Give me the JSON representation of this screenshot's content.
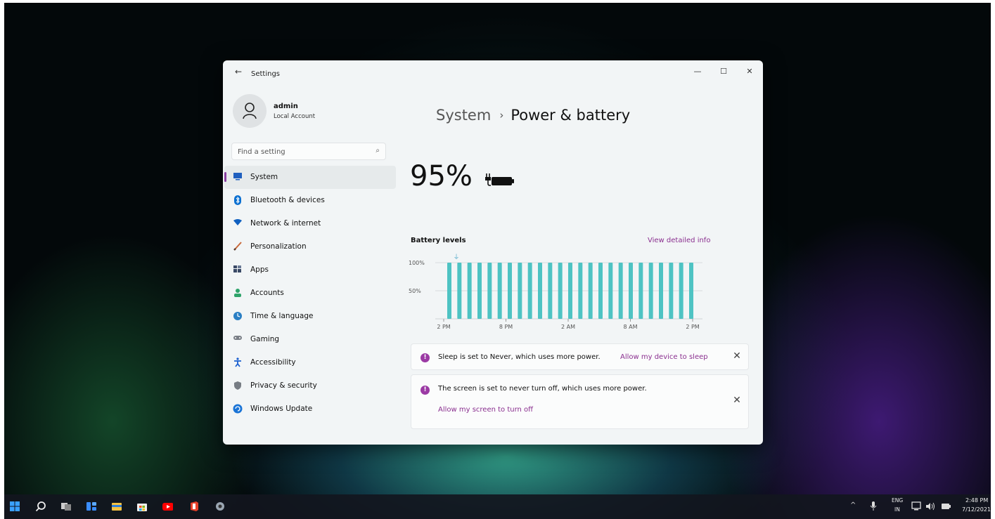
{
  "window": {
    "title": "Settings",
    "back_glyph": "←",
    "minimize_glyph": "—",
    "maximize_glyph": "☐",
    "close_glyph": "✕"
  },
  "user": {
    "name": "admin",
    "account_type": "Local Account"
  },
  "search": {
    "placeholder": "Find a setting"
  },
  "sidebar": {
    "items": [
      {
        "label": "System",
        "icon": "monitor-icon",
        "color": "#1f5fbf",
        "active": true
      },
      {
        "label": "Bluetooth & devices",
        "icon": "bluetooth-icon",
        "color": "#0a6fd1"
      },
      {
        "label": "Network & internet",
        "icon": "wifi-icon",
        "color": "#1060c0"
      },
      {
        "label": "Personalization",
        "icon": "brush-icon",
        "color": "#c9693a"
      },
      {
        "label": "Apps",
        "icon": "apps-icon",
        "color": "#3a4a66"
      },
      {
        "label": "Accounts",
        "icon": "person-icon",
        "color": "#2ea36a"
      },
      {
        "label": "Time & language",
        "icon": "globe-clock-icon",
        "color": "#2a7fc4"
      },
      {
        "label": "Gaming",
        "icon": "gamepad-icon",
        "color": "#7a7f87"
      },
      {
        "label": "Accessibility",
        "icon": "accessibility-icon",
        "color": "#1a5fd0"
      },
      {
        "label": "Privacy & security",
        "icon": "shield-icon",
        "color": "#777d84"
      },
      {
        "label": "Windows Update",
        "icon": "update-icon",
        "color": "#1a74d6"
      }
    ]
  },
  "header": {
    "parent": "System",
    "separator": "›",
    "current": "Power & battery"
  },
  "battery": {
    "percent_text": "95%",
    "charging": true
  },
  "chart_data": {
    "type": "bar",
    "title": "Battery levels",
    "y_ticks": [
      "100%",
      "50%"
    ],
    "ylim": [
      0,
      100
    ],
    "x_ticks": [
      "2 PM",
      "8 PM",
      "2 AM",
      "8 AM",
      "2 PM"
    ],
    "values": [
      100,
      100,
      100,
      100,
      100,
      100,
      100,
      100,
      100,
      100,
      100,
      100,
      100,
      100,
      100,
      100,
      100,
      100,
      100,
      100,
      100,
      100,
      100,
      100,
      100
    ],
    "bar_color": "#4ec3c3",
    "plug_marker": "⏚",
    "link": "View detailed info"
  },
  "notices": [
    {
      "text": "Sleep is set to Never, which uses more power.",
      "link": "Allow my device to sleep",
      "close": "✕"
    },
    {
      "text": "The screen is set to never turn off, which uses more power.",
      "link": "Allow my screen to turn off",
      "close": "✕"
    }
  ],
  "taskbar": {
    "apps": [
      "start-icon",
      "search-icon",
      "task-view-icon",
      "widgets-icon",
      "file-explorer-icon",
      "store-icon",
      "youtube-icon",
      "office-icon",
      "settings-icon"
    ],
    "tray": {
      "chevron": "^",
      "lang_top": "ENG",
      "lang_bottom": "IN",
      "time": "2:48 PM",
      "date": "7/12/2021"
    }
  }
}
